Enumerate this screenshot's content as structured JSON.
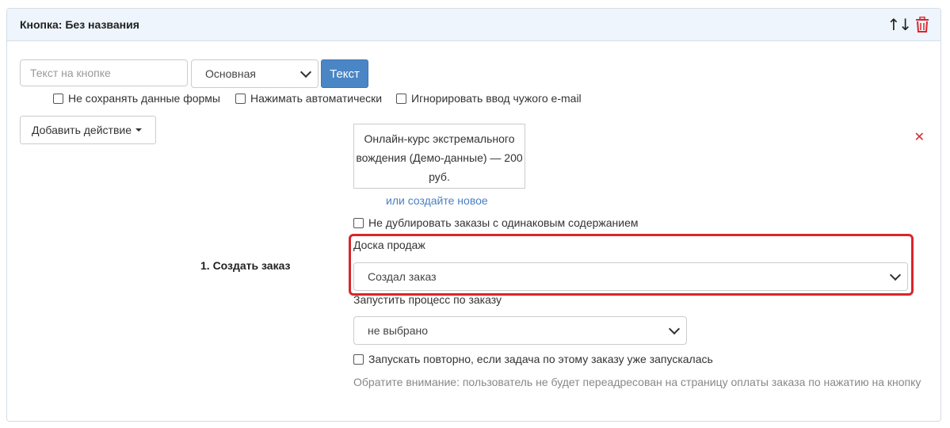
{
  "panel": {
    "title": "Кнопка: Без названия",
    "move_arrows": "↑↓"
  },
  "button_text_input": {
    "placeholder": "Текст на кнопке",
    "value": ""
  },
  "style_select": {
    "value": "Основная"
  },
  "text_button": "Текст",
  "options": {
    "no_save": "Не сохранять данные формы",
    "auto_press": "Нажимать автоматически",
    "ignore_email": "Игнорировать ввод чужого e-mail"
  },
  "add_action": "Добавить действие",
  "action": {
    "label": "1. Создать заказ",
    "product": "Онлайн-курс экстремального вождения (Демо-данные) — 200 руб.",
    "create_new_link": "или создайте новое",
    "no_duplicate": "Не дублировать заказы с одинаковым содержанием",
    "sales_board_label": "Доска продаж",
    "sales_board_value": "Создал заказ",
    "process_label": "Запустить процесс по заказу",
    "process_value": "не выбрано",
    "rerun": "Запускать повторно, если задача по этому заказу уже запускалась",
    "note": "Обратите внимание: пользователь не будет переадресован на страницу оплаты заказа по нажатию на кнопку"
  },
  "colors": {
    "accent": "#4a86c5",
    "danger": "#d9262b",
    "header_bg": "#eef5fc"
  }
}
